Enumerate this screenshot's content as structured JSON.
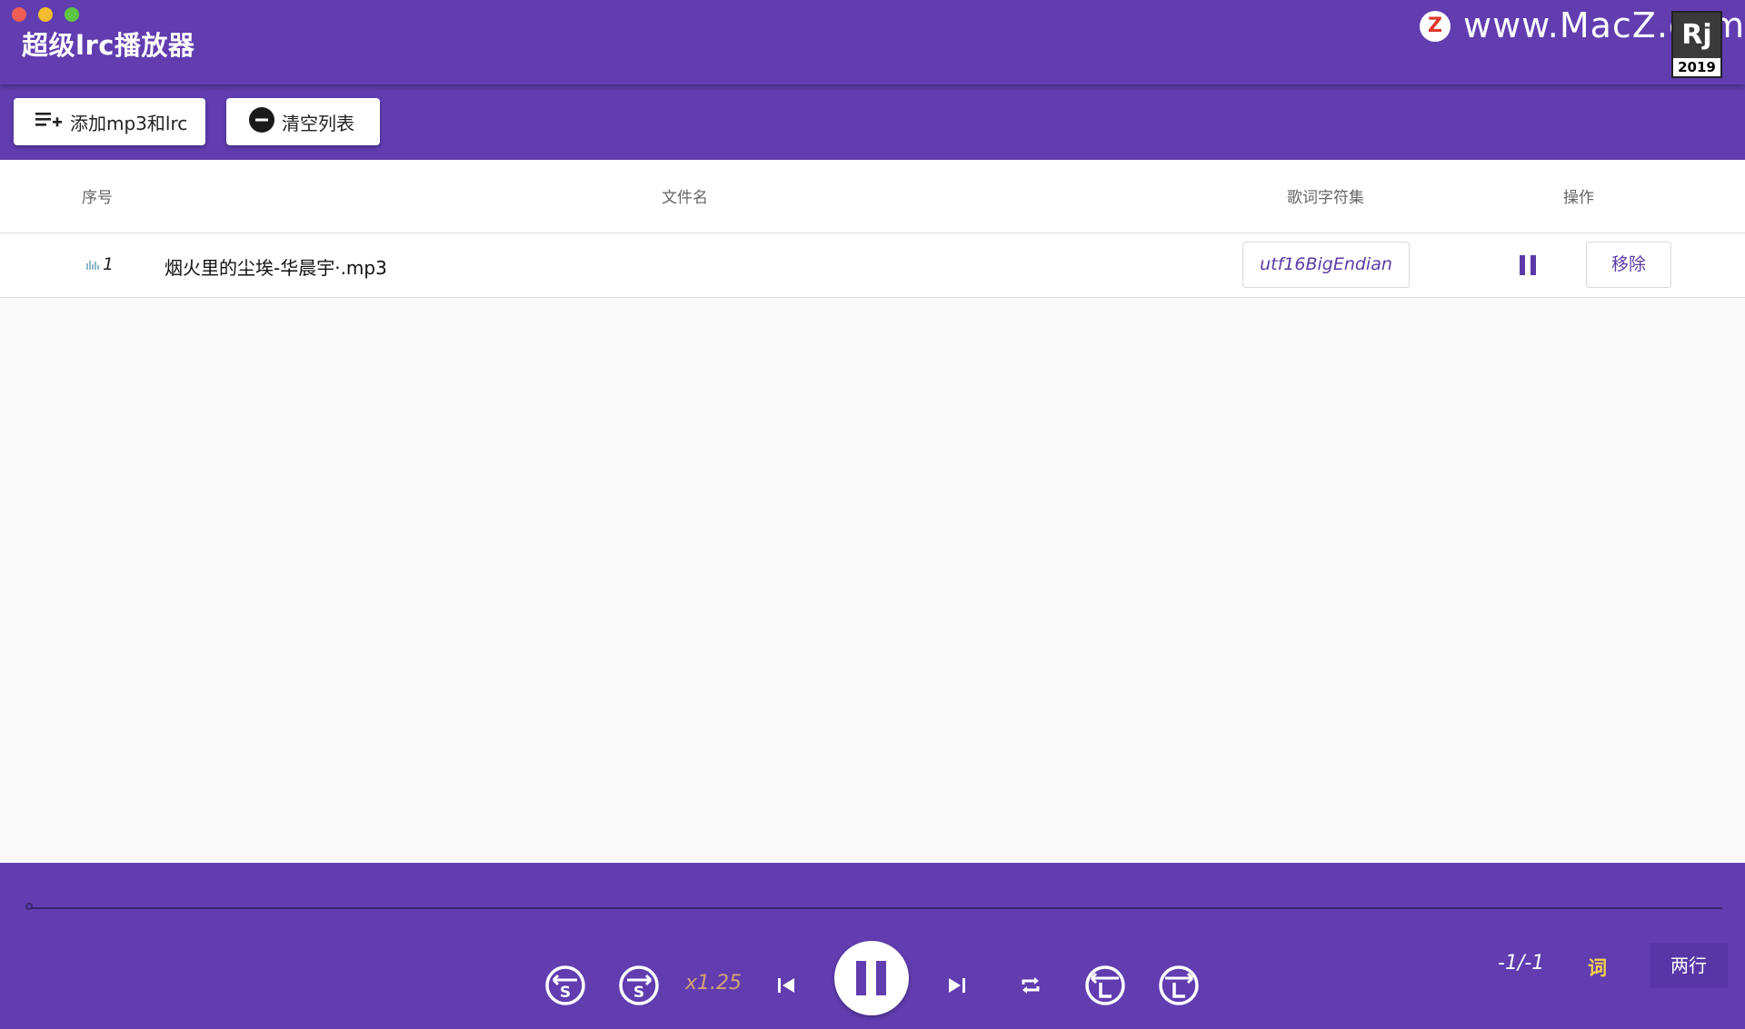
{
  "window": {
    "title": "超级lrc播放器"
  },
  "watermark": {
    "logo_letter": "Z",
    "text": "www.MacZ.com",
    "badge_top": "Rj",
    "badge_year": "2019"
  },
  "toolbar": {
    "add_label": "添加mp3和lrc",
    "clear_label": "清空列表",
    "add_icon": "playlist-add-icon",
    "clear_icon": "remove-circle-icon"
  },
  "table": {
    "headers": {
      "index": "序号",
      "filename": "文件名",
      "charset": "歌词字符集",
      "actions": "操作"
    },
    "rows": [
      {
        "index": "1",
        "filename": "烟火里的尘埃-华晨宇·.mp3",
        "charset": "utf16BigEndian",
        "remove_label": "移除",
        "playing": true
      }
    ]
  },
  "player": {
    "progress": 0,
    "speed": "x1.25",
    "counter": "-1/-1",
    "lyrics_label": "词",
    "lines_label": "两行",
    "accent": "#613db0",
    "speed_color": "#d4a373",
    "lyrics_color": "#f7d547"
  }
}
